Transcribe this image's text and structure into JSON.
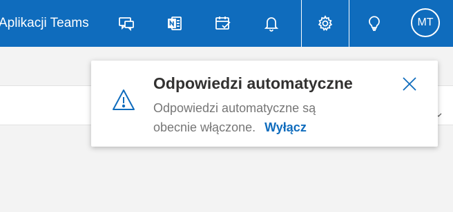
{
  "header": {
    "teams_link_label": "Aplikacji Teams",
    "icons": [
      "chat-icon",
      "onenote-icon",
      "calendar-check-icon",
      "bell-icon",
      "gear-icon",
      "lightbulb-icon"
    ],
    "avatar_initials": "MT"
  },
  "toast": {
    "title": "Odpowiedzi automatyczne",
    "message": "Odpowiedzi automatyczne są obecnie włączone.",
    "action_label": "Wyłącz",
    "close_icon": "close-icon",
    "warning_icon": "warning-icon"
  },
  "colors": {
    "header_bg": "#0f6cbd",
    "link": "#0f6cbd",
    "title": "#323130",
    "text": "#767676"
  }
}
